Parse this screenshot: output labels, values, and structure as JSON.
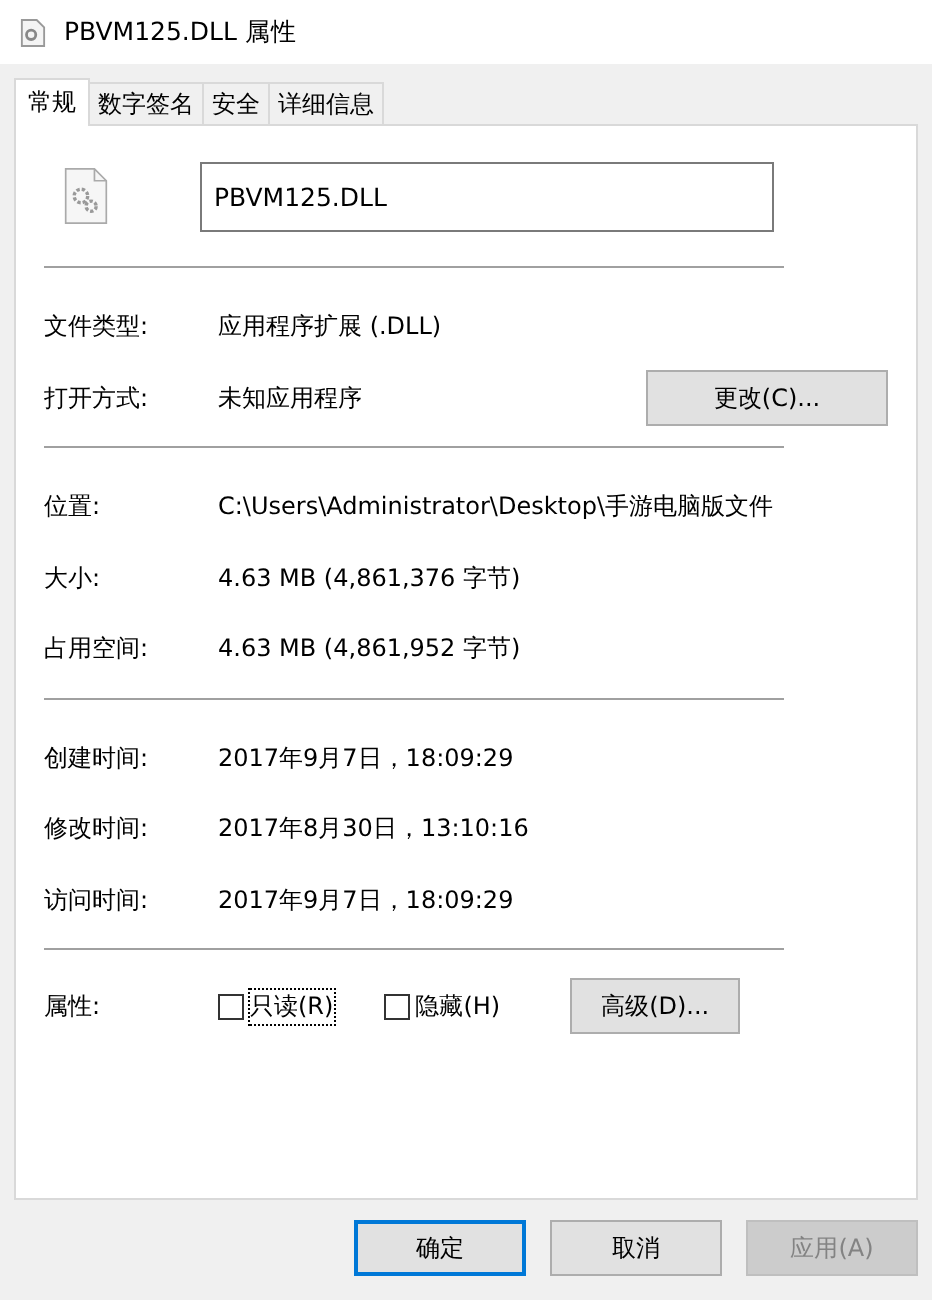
{
  "window": {
    "title": "PBVM125.DLL 属性"
  },
  "tabs": [
    {
      "label": "常规",
      "selected": true
    },
    {
      "label": "数字签名",
      "selected": false
    },
    {
      "label": "安全",
      "selected": false
    },
    {
      "label": "详细信息",
      "selected": false
    }
  ],
  "file_name": {
    "value": "PBVM125.DLL"
  },
  "sections": [
    [
      {
        "label": "文件类型:",
        "value": "应用程序扩展 (.DLL)"
      },
      {
        "label": "打开方式:",
        "value": "未知应用程序",
        "button": "更改(C)..."
      }
    ],
    [
      {
        "label": "位置:",
        "value": "C:\\Users\\Administrator\\Desktop\\手游电脑版文件"
      },
      {
        "label": "大小:",
        "value": "4.63 MB (4,861,376 字节)"
      },
      {
        "label": "占用空间:",
        "value": "4.63 MB (4,861,952 字节)"
      }
    ],
    [
      {
        "label": "创建时间:",
        "value": "2017年9月7日，18:09:29"
      },
      {
        "label": "修改时间:",
        "value": "2017年8月30日，13:10:16"
      },
      {
        "label": "访问时间:",
        "value": "2017年9月7日，18:09:29"
      }
    ]
  ],
  "attributes": {
    "label": "属性:",
    "checkboxes": [
      {
        "label": "只读(R)",
        "checked": false,
        "focused": true
      },
      {
        "label": "隐藏(H)",
        "checked": false,
        "focused": false
      }
    ],
    "button": "高级(D)..."
  },
  "buttons": [
    {
      "label": "确定",
      "default": true,
      "disabled": false
    },
    {
      "label": "取消",
      "default": false,
      "disabled": false
    },
    {
      "label": "应用(A)",
      "default": false,
      "disabled": true
    }
  ]
}
